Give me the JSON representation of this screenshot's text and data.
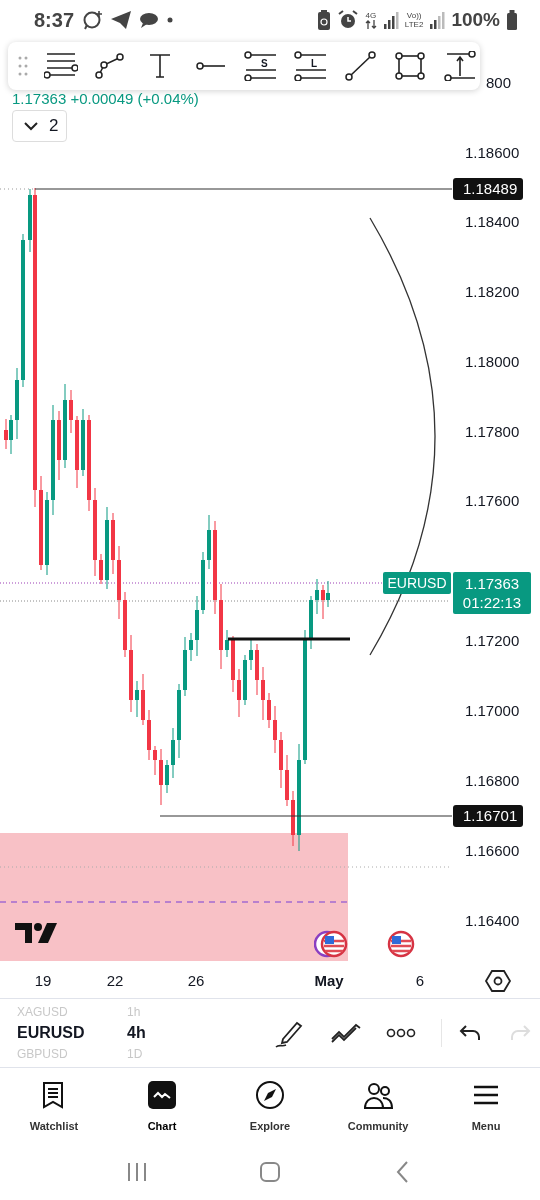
{
  "status_bar": {
    "time": "8:37",
    "network_1": "4G",
    "network_2_top": "Vo))",
    "network_2_bottom": "LTE2",
    "battery": "100%"
  },
  "drawing_toolbar": {
    "tools": [
      {
        "kind": "fib"
      },
      {
        "kind": "path"
      },
      {
        "kind": "text"
      },
      {
        "kind": "ray"
      },
      {
        "kind": "labeled",
        "letter": "S"
      },
      {
        "kind": "labeled",
        "letter": "L"
      },
      {
        "kind": "trend"
      },
      {
        "kind": "rect"
      },
      {
        "kind": "measure"
      }
    ]
  },
  "symbol_header": {
    "quote": "1.17363 +0.00049 (+0.04%)",
    "indicators_count": "2"
  },
  "price_axis": {
    "top_label": "800",
    "labels": [
      "1.18600",
      "1.18400",
      "1.18200",
      "1.18000",
      "1.17800",
      "1.17600",
      "1.17200",
      "1.17000",
      "1.16800",
      "1.16600",
      "1.16400"
    ]
  },
  "price_markers": [
    {
      "price": "1.18489"
    },
    {
      "price": "1.16701"
    }
  ],
  "last_price": {
    "symbol": "EURUSD",
    "price": "1.17363",
    "countdown": "01:22:13"
  },
  "time_axis": {
    "labels": [
      {
        "text": "19",
        "kind": "day"
      },
      {
        "text": "22",
        "kind": "day"
      },
      {
        "text": "26",
        "kind": "day"
      },
      {
        "text": "May",
        "kind": "month"
      },
      {
        "text": "6",
        "kind": "day"
      }
    ]
  },
  "symbol_picker": {
    "items": [
      {
        "symbol": "XAGUSD",
        "interval": "1h",
        "selected": false
      },
      {
        "symbol": "EURUSD",
        "interval": "4h",
        "selected": true
      },
      {
        "symbol": "GBPUSD",
        "interval": "1D",
        "selected": false
      }
    ]
  },
  "chart_actions": {
    "redo_disabled": true
  },
  "nav": {
    "items": [
      {
        "label": "Watchlist",
        "kind": "watchlist",
        "selected": false
      },
      {
        "label": "Chart",
        "kind": "chart",
        "selected": true
      },
      {
        "label": "Explore",
        "kind": "explore",
        "selected": false
      },
      {
        "label": "Community",
        "kind": "community",
        "selected": false
      },
      {
        "label": "Menu",
        "kind": "menu",
        "selected": false
      }
    ]
  }
}
